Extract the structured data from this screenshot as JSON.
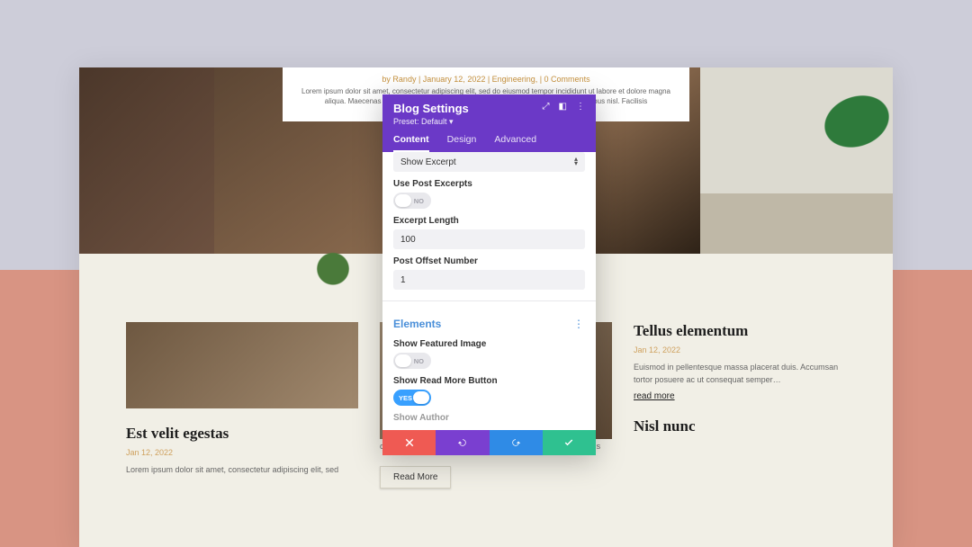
{
  "hero": {
    "byline": "by Randy | January 12, 2022 | Engineering, | 0 Comments",
    "excerpt": "Lorem ipsum dolor sit amet, consectetur adipiscing elit, sed do eiusmod tempor incididunt ut labore et dolore magna aliqua. Maecenas sed enim ut sem. Amet consectetur adipiscing elit ut aliquam faucibus nisl. Facilisis"
  },
  "cards": [
    {
      "title": "Est velit egestas",
      "date": "Jan 12, 2022",
      "excerpt": "Lorem ipsum dolor sit amet, consectetur adipiscing elit, sed"
    },
    {
      "title": "",
      "excerpt": "congue. Ut lectus arcu bibendum. Id leo in dui diam phasellus",
      "button": "Read More"
    },
    {
      "title": "Tellus elementum",
      "date": "Jan 12, 2022",
      "excerpt": "Euismod in pellentesque massa placerat duis. Accumsan tortor posuere ac ut consequat semper…",
      "link": "read more",
      "title2": "Nisl nunc"
    }
  ],
  "modal": {
    "title": "Blog Settings",
    "preset": "Preset: Default ▾",
    "tabs": {
      "content": "Content",
      "design": "Design",
      "advanced": "Advanced"
    },
    "excerpt_dropdown": "Show Excerpt",
    "fields": {
      "use_post_excerpts": {
        "label": "Use Post Excerpts",
        "value": "NO"
      },
      "excerpt_length": {
        "label": "Excerpt Length",
        "value": "100"
      },
      "post_offset": {
        "label": "Post Offset Number",
        "value": "1"
      }
    },
    "section": "Elements",
    "elements": {
      "show_featured_image": {
        "label": "Show Featured Image",
        "value": "NO"
      },
      "show_read_more": {
        "label": "Show Read More Button",
        "value": "YES"
      },
      "show_author": {
        "label": "Show Author"
      }
    }
  }
}
